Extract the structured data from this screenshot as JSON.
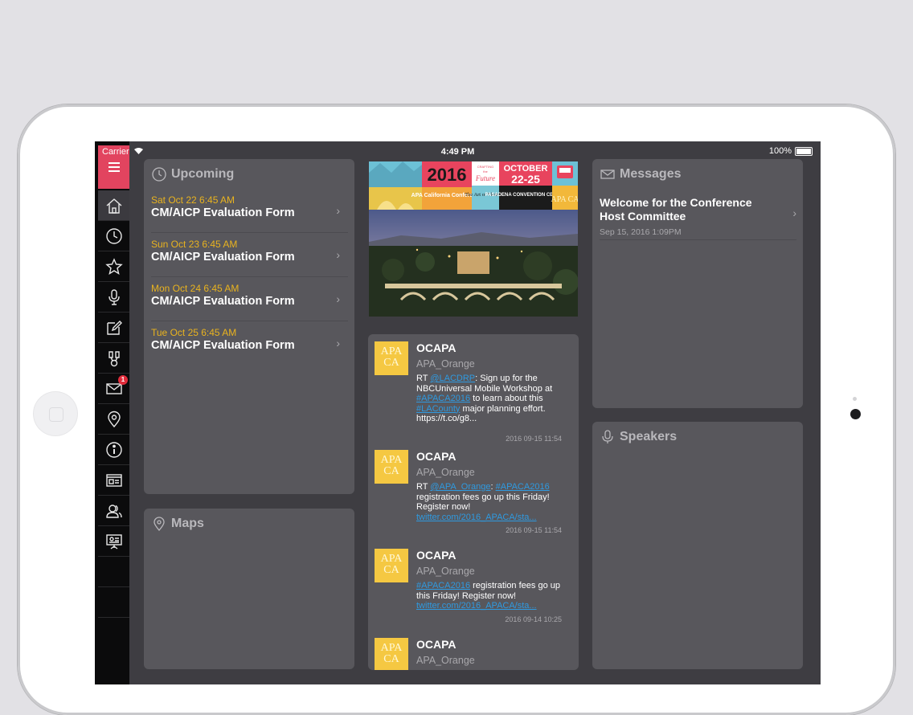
{
  "status_bar": {
    "carrier": "Carrier",
    "time": "4:49 PM",
    "battery": "100%"
  },
  "sidebar": {
    "items": [
      {
        "icon": "home-icon"
      },
      {
        "icon": "clock-icon"
      },
      {
        "icon": "star-icon"
      },
      {
        "icon": "microphone-icon"
      },
      {
        "icon": "edit-icon"
      },
      {
        "icon": "sponsor-icon"
      },
      {
        "icon": "mail-icon",
        "badge": "1"
      },
      {
        "icon": "map-pin-icon"
      },
      {
        "icon": "info-icon"
      },
      {
        "icon": "news-icon"
      },
      {
        "icon": "people-icon"
      },
      {
        "icon": "presentation-icon"
      }
    ]
  },
  "upcoming": {
    "title": "Upcoming",
    "items": [
      {
        "date": "Sat Oct 22 6:45 AM",
        "title": "CM/AICP Evaluation Form"
      },
      {
        "date": "Sun Oct 23 6:45 AM",
        "title": "CM/AICP Evaluation Form"
      },
      {
        "date": "Mon Oct 24 6:45 AM",
        "title": "CM/AICP Evaluation Form"
      },
      {
        "date": "Tue Oct 25 6:45 AM",
        "title": "CM/AICP Evaluation Form"
      }
    ]
  },
  "maps": {
    "title": "Maps"
  },
  "banner": {
    "year": "2016",
    "org": "APA California Conference",
    "tagline_1": "CRAFTING",
    "tagline_2": "the",
    "tagline_3": "Future",
    "art": "The Art of Planning",
    "month": "OCTOBER",
    "days": "22-25",
    "venue": "PASADENA CONVENTION CENTER",
    "logo": "APA CA"
  },
  "feed": {
    "tweets": [
      {
        "name": "OCAPA",
        "handle": "APA_Orange",
        "logo": "APA CA",
        "parts": [
          {
            "t": "RT "
          },
          {
            "t": "@LACDRP",
            "link": true
          },
          {
            "t": ": Sign up for the NBCUniversal Mobile Workshop at "
          },
          {
            "t": "#APACA2016",
            "link": true
          },
          {
            "t": " to learn about this "
          },
          {
            "t": "#LACounty",
            "link": true
          },
          {
            "t": " major planning effort. https://t.co/g8..."
          }
        ],
        "time": "2016 09-15 11:54"
      },
      {
        "name": "OCAPA",
        "handle": "APA_Orange",
        "logo": "APA CA",
        "parts": [
          {
            "t": "RT "
          },
          {
            "t": "@APA_Orange",
            "link": true
          },
          {
            "t": ": "
          },
          {
            "t": "#APACA2016",
            "link": true
          },
          {
            "t": " registration fees go up this Friday! Register now! "
          },
          {
            "t": "twitter.com/2016_APACA/sta...",
            "link": true
          }
        ],
        "time": "2016 09-15 11:54"
      },
      {
        "name": "OCAPA",
        "handle": "APA_Orange",
        "logo": "APA CA",
        "parts": [
          {
            "t": "#APACA2016",
            "link": true
          },
          {
            "t": " registration fees go up this Friday! Register now! "
          },
          {
            "t": "twitter.com/2016_APACA/sta...",
            "link": true
          }
        ],
        "time": "2016 09-14 10:25"
      },
      {
        "name": "OCAPA",
        "handle": "APA_Orange",
        "logo": "APA CA",
        "parts": [],
        "time": ""
      }
    ]
  },
  "messages": {
    "title": "Messages",
    "items": [
      {
        "title": "Welcome for the Conference Host Committee",
        "date": "Sep 15, 2016 1:09PM"
      }
    ]
  },
  "speakers": {
    "title": "Speakers"
  },
  "colors": {
    "accent": "#e2445f",
    "date": "#e9b31f",
    "link": "#2f9ae0"
  }
}
